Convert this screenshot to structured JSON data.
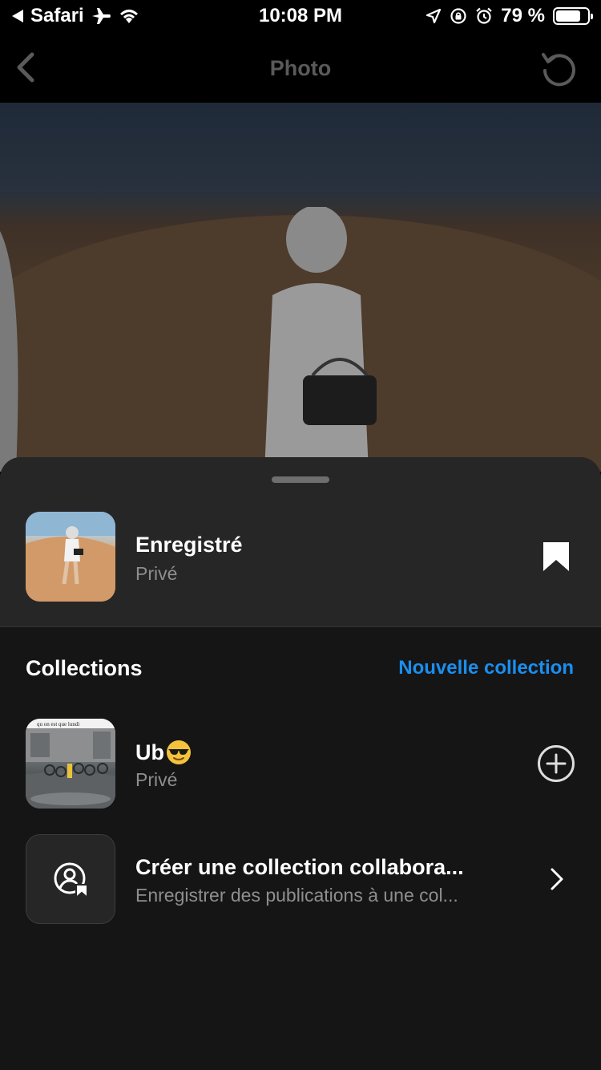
{
  "status_bar": {
    "back_app": "Safari",
    "time": "10:08 PM",
    "battery": "79 %"
  },
  "nav": {
    "title": "Photo"
  },
  "saved": {
    "title": "Enregistré",
    "privacy": "Privé"
  },
  "collections": {
    "heading": "Collections",
    "new_label": "Nouvelle collection",
    "items": [
      {
        "name": "Ub",
        "emoji": "sunglasses-face",
        "privacy": "Privé",
        "thumb_caption": "qu on est que lundi"
      }
    ]
  },
  "collab": {
    "title": "Créer une collection collabora...",
    "subtitle": "Enregistrer des publications à une col..."
  },
  "colors": {
    "accent": "#1a8ff0",
    "sheet": "#151515",
    "sheet_top": "#262626",
    "muted_text": "#8e8e8e"
  }
}
